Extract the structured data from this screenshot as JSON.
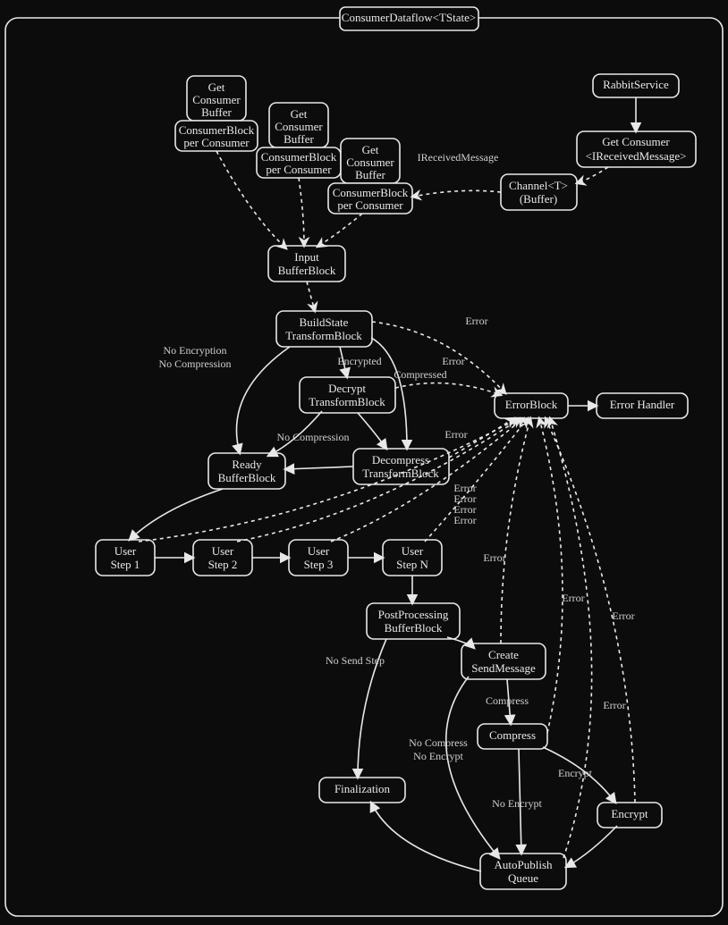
{
  "title": "ConsumerDataflow<TState>",
  "nodes": {
    "rabbit": {
      "l1": "RabbitService"
    },
    "getcon_im": {
      "l1": "Get Consumer",
      "l2": "<IReceivedMessage>"
    },
    "chanbuf": {
      "l1": "Channel<T>",
      "l2": "(Buffer)"
    },
    "gcb1a": {
      "l1": "Get",
      "l2": "Consumer",
      "l3": "Buffer"
    },
    "gcb1b": {
      "l1": "ConsumerBlock",
      "l2": "per Consumer"
    },
    "gcb2a": {
      "l1": "Get",
      "l2": "Consumer",
      "l3": "Buffer"
    },
    "gcb2b": {
      "l1": "ConsumerBlock",
      "l2": "per Consumer"
    },
    "gcb3a": {
      "l1": "Get",
      "l2": "Consumer",
      "l3": "Buffer"
    },
    "gcb3b": {
      "l1": "ConsumerBlock",
      "l2": "per Consumer"
    },
    "input": {
      "l1": "Input",
      "l2": "BufferBlock"
    },
    "build": {
      "l1": "BuildState",
      "l2": "TransformBlock"
    },
    "decrypt": {
      "l1": "Decrypt",
      "l2": "TransformBlock"
    },
    "decomp": {
      "l1": "Decompress",
      "l2": "TransformBlock"
    },
    "ready": {
      "l1": "Ready",
      "l2": "BufferBlock"
    },
    "errblk": {
      "l1": "ErrorBlock"
    },
    "errhand": {
      "l1": "Error Handler"
    },
    "u1": {
      "l1": "User",
      "l2": "Step 1"
    },
    "u2": {
      "l1": "User",
      "l2": "Step 2"
    },
    "u3": {
      "l1": "User",
      "l2": "Step 3"
    },
    "uN": {
      "l1": "User",
      "l2": "Step N"
    },
    "post": {
      "l1": "PostProcessing",
      "l2": "BufferBlock"
    },
    "csm": {
      "l1": "Create",
      "l2": "SendMessage"
    },
    "compress": {
      "l1": "Compress"
    },
    "encrypt": {
      "l1": "Encrypt"
    },
    "autopub": {
      "l1": "AutoPublish",
      "l2": "Queue"
    },
    "final": {
      "l1": "Finalization"
    }
  },
  "labels": {
    "irecv": "IReceivedMessage",
    "noenc_nocmp": "No Encryption",
    "noenc_nocmp2": "No Compression",
    "encrypted": "Encrypted",
    "compressed": "Compressed",
    "nocmp": "No Compression",
    "err": "Error",
    "nosend": "No Send Step",
    "cmpword": "Compress",
    "nocmp_noenc1": "No Compress",
    "nocmp_noenc2": "No Encrypt",
    "noencrypt": "No Encrypt",
    "encword": "Encrypt"
  }
}
